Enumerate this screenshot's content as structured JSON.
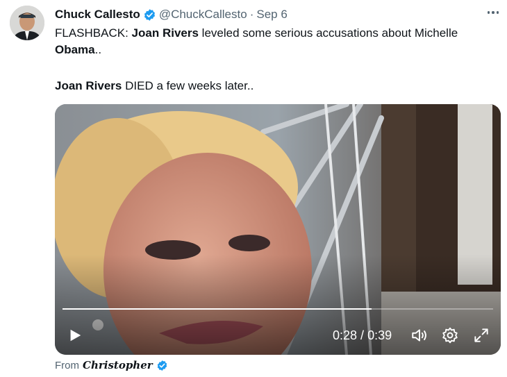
{
  "tweet": {
    "author_name": "Chuck Callesto",
    "handle": "@ChuckCallesto",
    "separator": "·",
    "date": "Sep 6",
    "text_parts": {
      "p1": "FLASHBACK: ",
      "p2": "Joan Rivers",
      "p3": " leveled some serious accusations about Michelle ",
      "p4": "Obama",
      "p5": "..",
      "p6": "Joan Rivers",
      "p7": " DIED a few weeks later.."
    }
  },
  "video": {
    "current_time": "0:28",
    "time_separator": " / ",
    "duration": "0:39",
    "progress_fraction": 0.718
  },
  "attribution": {
    "label": "From",
    "name": "Christopher"
  },
  "colors": {
    "verified_blue": "#1d9bf0",
    "text_primary": "#0f1419",
    "text_secondary": "#536471"
  }
}
